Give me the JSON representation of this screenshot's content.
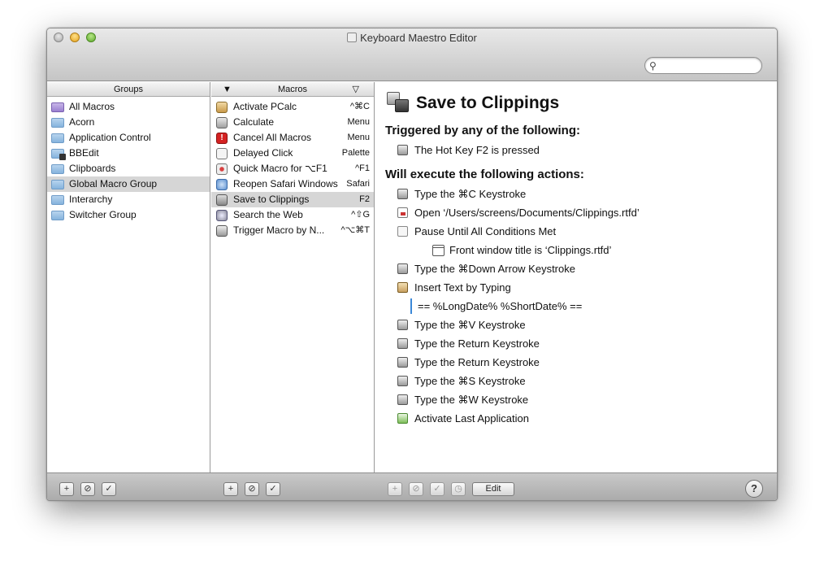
{
  "window": {
    "title": "Keyboard Maestro Editor",
    "search_placeholder": ""
  },
  "groups": {
    "header": "Groups",
    "items": [
      {
        "label": "All Macros",
        "icon": "smart-folder-icon"
      },
      {
        "label": "Acorn",
        "icon": "folder-icon"
      },
      {
        "label": "Application Control",
        "icon": "folder-icon"
      },
      {
        "label": "BBEdit",
        "icon": "app-folder-icon"
      },
      {
        "label": "Clipboards",
        "icon": "folder-icon"
      },
      {
        "label": "Global Macro Group",
        "icon": "folder-icon"
      },
      {
        "label": "Interarchy",
        "icon": "folder-icon"
      },
      {
        "label": "Switcher Group",
        "icon": "folder-icon"
      }
    ],
    "selected_index": 5
  },
  "macros": {
    "header": "Macros",
    "items": [
      {
        "label": "Activate PCalc",
        "key": "^⌘C",
        "icon": "activate-icon"
      },
      {
        "label": "Calculate",
        "key": "Menu",
        "icon": "calculator-icon"
      },
      {
        "label": "Cancel All Macros",
        "key": "Menu",
        "icon": "stop-icon"
      },
      {
        "label": "Delayed Click",
        "key": "Palette",
        "icon": "clock-icon"
      },
      {
        "label": "Quick Macro for ⌥F1",
        "key": "^F1",
        "icon": "record-icon"
      },
      {
        "label": "Reopen Safari Windows",
        "key": "Safari",
        "icon": "safari-icon"
      },
      {
        "label": "Save to Clippings",
        "key": "F2",
        "icon": "clipping-icon"
      },
      {
        "label": "Search the Web",
        "key": "^⇧G",
        "icon": "web-icon"
      },
      {
        "label": "Trigger Macro by N...",
        "key": "^⌥⌘T",
        "icon": "keyboard-icon"
      }
    ],
    "selected_index": 6
  },
  "detail": {
    "title": "Save to Clippings",
    "triggers_heading": "Triggered by any of the following:",
    "trigger": "The Hot Key F2 is pressed",
    "actions_heading": "Will execute the following actions:",
    "actions": [
      {
        "text": "Type the ⌘C Keystroke",
        "kind": "key"
      },
      {
        "text": "Open ‘/Users/screens/Documents/Clippings.rtfd’",
        "kind": "doc"
      },
      {
        "text": "Pause Until All Conditions Met",
        "kind": "clock"
      },
      {
        "text": "Front window title is ‘Clippings.rtfd’",
        "kind": "window"
      },
      {
        "text": "Type the ⌘Down Arrow Keystroke",
        "kind": "key"
      },
      {
        "text": "Insert Text by Typing",
        "kind": "insert"
      },
      {
        "text": "== %LongDate% %ShortDate% ==",
        "kind": "text"
      },
      {
        "text": "Type the ⌘V Keystroke",
        "kind": "key"
      },
      {
        "text": "Type the Return Keystroke",
        "kind": "key"
      },
      {
        "text": "Type the Return Keystroke",
        "kind": "key"
      },
      {
        "text": "Type the ⌘S Keystroke",
        "kind": "key"
      },
      {
        "text": "Type the ⌘W Keystroke",
        "kind": "key"
      },
      {
        "text": "Activate Last Application",
        "kind": "app"
      }
    ]
  },
  "toolbar": {
    "add": "+",
    "disable": "⊘",
    "enable": "✓",
    "timer": "◷",
    "edit_label": "Edit",
    "help": "?"
  }
}
